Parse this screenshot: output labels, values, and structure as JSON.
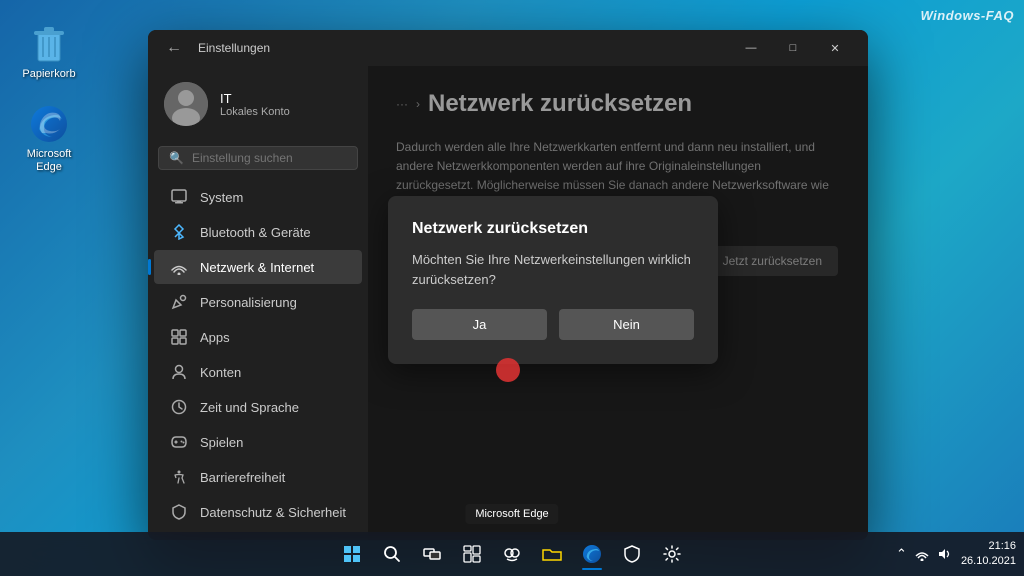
{
  "watermark": "Windows-FAQ",
  "desktop": {
    "icons": [
      {
        "id": "papierkorb",
        "label": "Papierkorb",
        "type": "recycle-bin"
      },
      {
        "id": "microsoft-edge",
        "label": "Microsoft Edge",
        "type": "edge"
      }
    ]
  },
  "taskbar": {
    "time": "21:16",
    "date": "26.10.2021",
    "tooltip": "Microsoft Edge",
    "centerIcons": [
      "start",
      "search",
      "taskview",
      "widgets",
      "chat",
      "explorer",
      "edge",
      "shield",
      "settings"
    ]
  },
  "settings": {
    "window_title": "Einstellungen",
    "back_btn": "←",
    "user": {
      "name": "IT",
      "type": "Lokales Konto"
    },
    "search_placeholder": "Einstellung suchen",
    "sidebar_items": [
      {
        "id": "system",
        "label": "System",
        "icon": "🖥"
      },
      {
        "id": "bluetooth",
        "label": "Bluetooth & Geräte",
        "icon": "🔵"
      },
      {
        "id": "network",
        "label": "Netzwerk & Internet",
        "icon": "🌐",
        "active": true
      },
      {
        "id": "personalization",
        "label": "Personalisierung",
        "icon": "✏"
      },
      {
        "id": "apps",
        "label": "Apps",
        "icon": "📦"
      },
      {
        "id": "accounts",
        "label": "Konten",
        "icon": "👤"
      },
      {
        "id": "time",
        "label": "Zeit und Sprache",
        "icon": "🕐"
      },
      {
        "id": "gaming",
        "label": "Spielen",
        "icon": "🎮"
      },
      {
        "id": "accessibility",
        "label": "Barrierefreiheit",
        "icon": "♿"
      },
      {
        "id": "privacy",
        "label": "Datenschutz & Sicherheit",
        "icon": "🛡"
      }
    ],
    "page": {
      "breadcrumb_dots": "···",
      "breadcrumb_sep": ">",
      "title": "Netzwerk zurücksetzen",
      "description": "Dadurch werden alle Ihre Netzwerkkarten entfernt und dann neu installiert, und andere Netzwerkkomponenten werden auf ihre Originaleinstellungen zurückgesetzt. Möglicherweise müssen Sie danach andere Netzwerksoftware wie VPN-Clientsoftware oder virtuelle Switches neu installieren.",
      "reset_btn_label": "Jetzt zurücksetzen"
    },
    "dialog": {
      "title": "Netzwerk zurücksetzen",
      "message": "Möchten Sie Ihre Netzwerkeinstellungen wirklich zurücksetzen?",
      "btn_ja": "Ja",
      "btn_nein": "Nein"
    }
  }
}
